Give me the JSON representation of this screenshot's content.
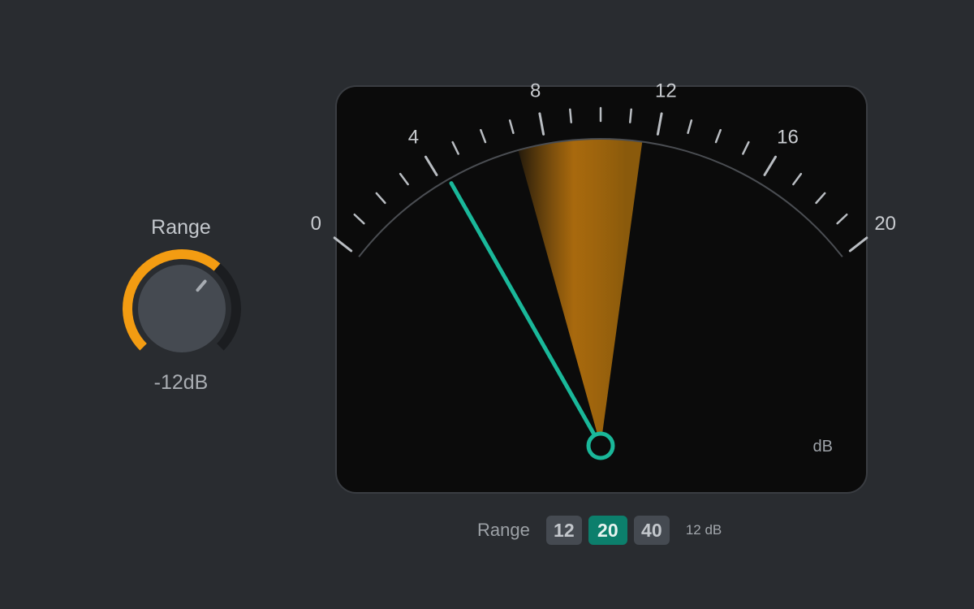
{
  "colors": {
    "background": "#292c30",
    "accent_orange": "#f39c12",
    "needle_teal": "#1ab89a",
    "active_button": "#0c7f6c"
  },
  "knob": {
    "label": "Range",
    "value_text": "-12dB",
    "level_fraction": 0.65
  },
  "meter": {
    "scale_labels": [
      "0",
      "4",
      "8",
      "12",
      "16",
      "20"
    ],
    "scale_min": 0,
    "scale_max": 20,
    "needle_value": 4.3,
    "peak_band_low": 7.0,
    "peak_band_high": 11.5,
    "unit": "dB"
  },
  "range_selector": {
    "label": "Range",
    "options": [
      "12",
      "20",
      "40"
    ],
    "selected": "20",
    "current_text": "12 dB"
  }
}
